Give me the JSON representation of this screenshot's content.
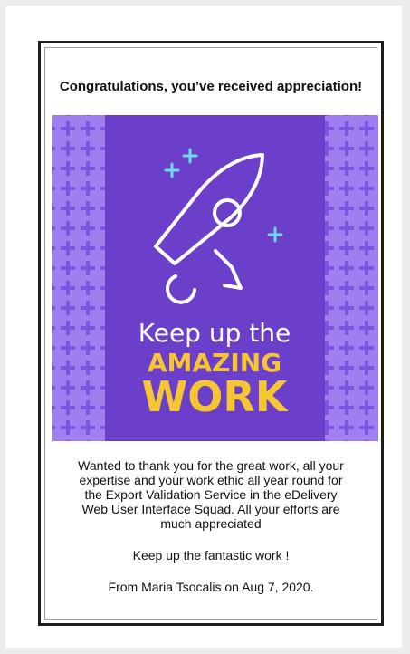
{
  "card": {
    "headline": "Congratulations, you’ve received appreciation!",
    "banner": {
      "line1": "Keep up the",
      "line2": "AMAZING",
      "line3": "WORK",
      "colors": {
        "pattern_bg": "#a07ef0",
        "pattern_plus": "#7c55e0",
        "panel": "#6c3fcb",
        "white": "#ffffff",
        "yellow": "#f5c632",
        "sparkle": "#6fd8f2"
      },
      "icon": "rocket-icon"
    },
    "message": "Wanted to thank you for the great work, all your expertise and your work ethic all year round for the Export Validation Service in the eDelivery Web User Interface Squad. All your efforts are much appreciated",
    "closing": "Keep up the fantastic work !",
    "signature": "From Maria Tsocalis on Aug 7, 2020."
  }
}
